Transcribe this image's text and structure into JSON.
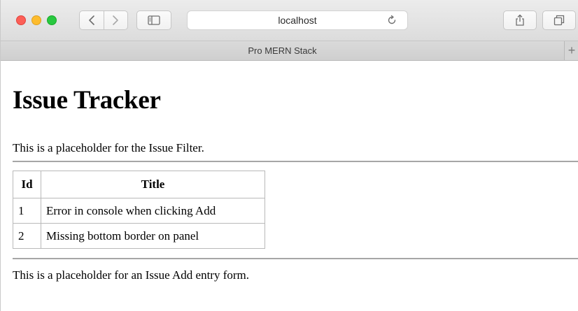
{
  "browser": {
    "address_url": "localhost",
    "tab_title": "Pro MERN Stack",
    "new_tab_label": "+"
  },
  "page": {
    "heading": "Issue Tracker",
    "filter_placeholder": "This is a placeholder for the Issue Filter.",
    "table": {
      "headers": [
        "Id",
        "Title"
      ],
      "rows": [
        [
          "1",
          "Error in console when clicking Add"
        ],
        [
          "2",
          "Missing bottom border on panel"
        ]
      ]
    },
    "add_placeholder": "This is a placeholder for an Issue Add entry form."
  },
  "icons": {
    "back": "chevron-left-icon",
    "forward": "chevron-right-icon",
    "sidebar": "sidebar-icon",
    "reload": "reload-icon",
    "share": "share-icon",
    "tabs": "tabs-overview-icon"
  },
  "colors": {
    "close": "#fc5f57",
    "minimize": "#fdbc2e",
    "zoom": "#28c840"
  }
}
